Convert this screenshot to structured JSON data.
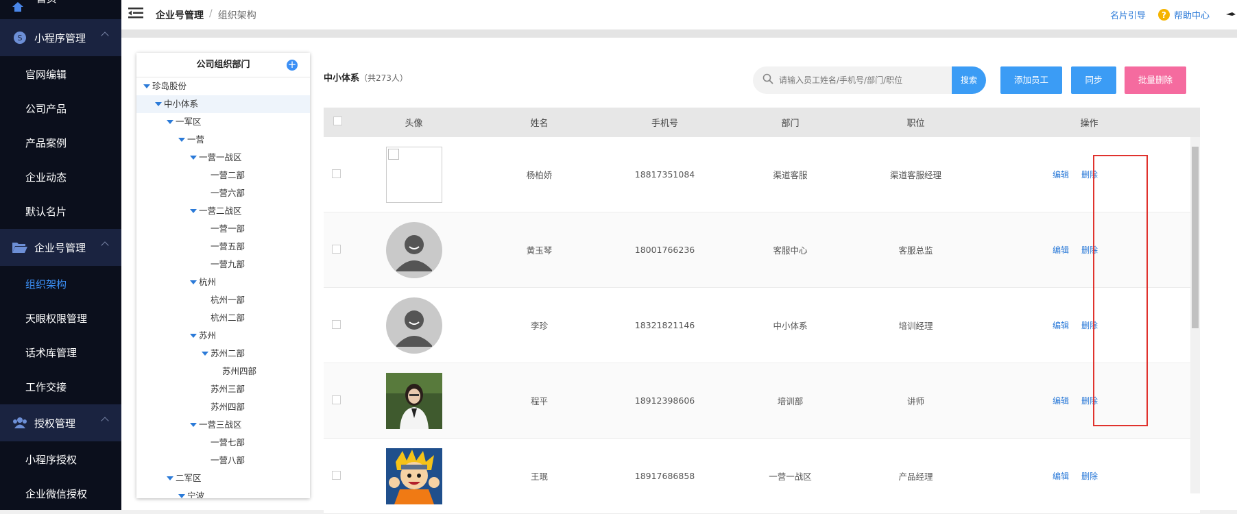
{
  "sidebar": {
    "home_label": "首页",
    "groups": [
      {
        "label": "小程序管理",
        "icon": "miniapp-icon"
      },
      {
        "label": "企业号管理",
        "icon": "folder-open-icon"
      },
      {
        "label": "授权管理",
        "icon": "users-icon"
      }
    ],
    "miniapp_items": [
      "官网编辑",
      "公司产品",
      "产品案例",
      "企业动态",
      "默认名片"
    ],
    "enterprise_items": [
      "组织架构",
      "天眼权限管理",
      "话术库管理",
      "工作交接"
    ],
    "auth_items": [
      "小程序授权",
      "企业微信授权"
    ]
  },
  "topbar": {
    "breadcrumb_parent": "企业号管理",
    "breadcrumb_sep": "/",
    "breadcrumb_current": "组织架构",
    "card_guide": "名片引导",
    "help_center": "帮助中心"
  },
  "tree": {
    "title": "公司组织部门",
    "add_symbol": "+",
    "nodes": [
      {
        "label": "珍岛股份",
        "level": 0,
        "expanded": true
      },
      {
        "label": "中小体系",
        "level": 1,
        "expanded": true,
        "selected": true
      },
      {
        "label": "一军区",
        "level": 2,
        "expanded": true
      },
      {
        "label": "一营",
        "level": 3,
        "expanded": true
      },
      {
        "label": "一营一战区",
        "level": 4,
        "expanded": true
      },
      {
        "label": "一营二部",
        "level": 5
      },
      {
        "label": "一营六部",
        "level": 5
      },
      {
        "label": "一营二战区",
        "level": 4,
        "expanded": true
      },
      {
        "label": "一营一部",
        "level": 5
      },
      {
        "label": "一营五部",
        "level": 5
      },
      {
        "label": "一营九部",
        "level": 5
      },
      {
        "label": "杭州",
        "level": 4,
        "expanded": true
      },
      {
        "label": "杭州一部",
        "level": 5
      },
      {
        "label": "杭州二部",
        "level": 5
      },
      {
        "label": "苏州",
        "level": 4,
        "expanded": true
      },
      {
        "label": "苏州二部",
        "level": 5,
        "expanded": true
      },
      {
        "label": "苏州四部",
        "level": 6
      },
      {
        "label": "苏州三部",
        "level": 5
      },
      {
        "label": "苏州四部",
        "level": 5
      },
      {
        "label": "一营三战区",
        "level": 4,
        "expanded": true
      },
      {
        "label": "一营七部",
        "level": 5
      },
      {
        "label": "一营八部",
        "level": 5
      },
      {
        "label": "二军区",
        "level": 2,
        "expanded": true
      },
      {
        "label": "宁波",
        "level": 3,
        "expanded": true
      }
    ]
  },
  "list": {
    "dept_name": "中小体系",
    "count_text": "（共273人）",
    "search_placeholder": "请输入员工姓名/手机号/部门/职位",
    "search_btn": "搜索",
    "add_btn": "添加员工",
    "sync_btn": "同步",
    "batch_delete_btn": "批量删除",
    "columns": [
      "头像",
      "姓名",
      "手机号",
      "部门",
      "职位",
      "操作"
    ],
    "edit_label": "编辑",
    "delete_label": "删除",
    "rows": [
      {
        "avatar": "blank",
        "name": "杨柏娇",
        "phone": "18817351084",
        "dept": "渠道客服",
        "position": "渠道客服经理"
      },
      {
        "avatar": "default-person",
        "name": "黄玉琴",
        "phone": "18001766236",
        "dept": "客服中心",
        "position": "客服总监"
      },
      {
        "avatar": "default-person",
        "name": "李珍",
        "phone": "18321821146",
        "dept": "中小体系",
        "position": "培训经理"
      },
      {
        "avatar": "photo-woman",
        "name": "程平",
        "phone": "18912398606",
        "dept": "培训部",
        "position": "讲师"
      },
      {
        "avatar": "cartoon-naruto",
        "name": "王珉",
        "phone": "18917686858",
        "dept": "一营一战区",
        "position": "产品经理"
      }
    ]
  },
  "colors": {
    "sidebar_bg": "#0b0f1c",
    "sidebar_group_bg": "#1a2340",
    "accent": "#3b9cf5",
    "danger_btn": "#f56b9f",
    "highlight_box": "#e0322d"
  }
}
